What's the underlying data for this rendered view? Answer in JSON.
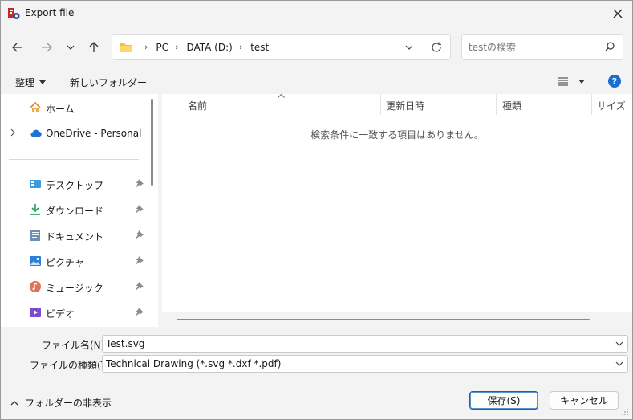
{
  "window": {
    "title": "Export file"
  },
  "address": {
    "crumbs": [
      "PC",
      "DATA (D:)",
      "test"
    ]
  },
  "search": {
    "placeholder": "testの検索"
  },
  "toolbar": {
    "organize_label": "整理",
    "new_folder_label": "新しいフォルダー"
  },
  "sidebar": {
    "home_label": "ホーム",
    "onedrive_label": "OneDrive - Personal",
    "pinned": [
      {
        "label": "デスクトップ",
        "icon": "desktop-icon"
      },
      {
        "label": "ダウンロード",
        "icon": "download-icon"
      },
      {
        "label": "ドキュメント",
        "icon": "document-icon"
      },
      {
        "label": "ピクチャ",
        "icon": "pictures-icon"
      },
      {
        "label": "ミュージック",
        "icon": "music-icon"
      },
      {
        "label": "ビデオ",
        "icon": "video-icon"
      }
    ]
  },
  "filelist": {
    "columns": [
      "名前",
      "更新日時",
      "種類",
      "サイズ"
    ],
    "empty_message": "検索条件に一致する項目はありません。"
  },
  "form": {
    "filename_label": "ファイル名(N):",
    "filename_value": "Test.svg",
    "filetype_label": "ファイルの種類(T):",
    "filetype_value": "Technical Drawing (*.svg *.dxf *.pdf)"
  },
  "footer": {
    "hide_folders_label": "フォルダーの非表示",
    "save_label": "保存(S)",
    "cancel_label": "キャンセル"
  },
  "colors": {
    "accent": "#1a6fce",
    "folder": "#f4c13b"
  }
}
